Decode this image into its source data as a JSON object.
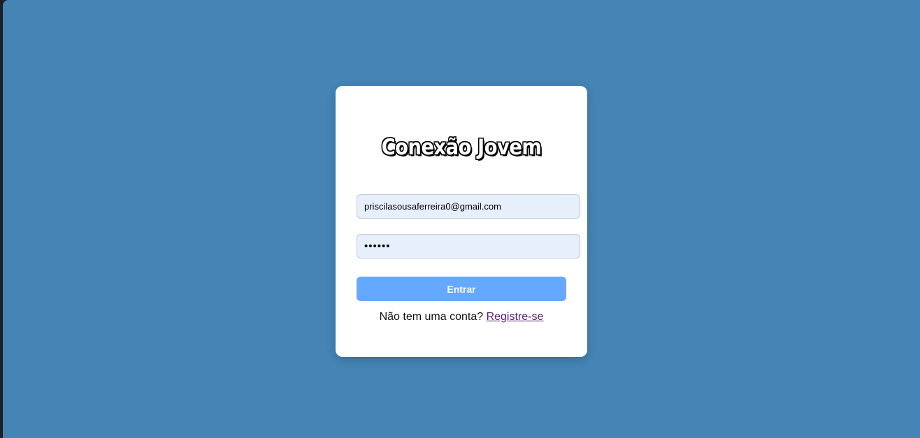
{
  "brand": {
    "title": "Conexão Jovem"
  },
  "login": {
    "email_value": "priscilasousaferreira0@gmail.com",
    "password_value": "••••••",
    "submit_label": "Entrar",
    "signup_prompt": "Não tem uma conta?",
    "signup_link": "Registre-se"
  },
  "colors": {
    "background": "#4584b5",
    "card": "#ffffff",
    "input_bg": "#e8effc",
    "button": "#64a8ff",
    "link": "#5a1e7a"
  }
}
